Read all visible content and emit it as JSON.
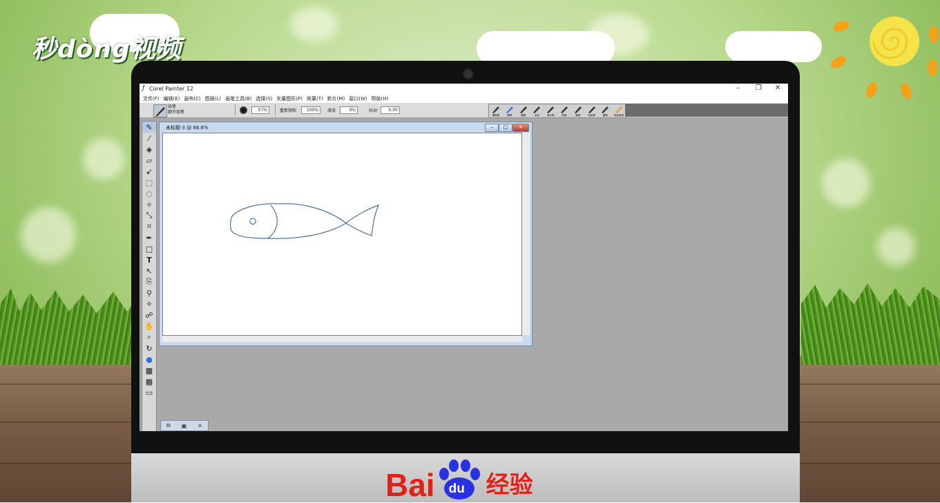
{
  "watermark": {
    "top_logo": "秒dòng视频"
  },
  "brand": {
    "bai": "Bai",
    "du": "du",
    "suffix": "经验"
  },
  "app": {
    "title": "Corel Painter 12",
    "window_controls": [
      "–",
      "❐",
      "✕"
    ],
    "menu": [
      "文件(F)",
      "编辑(E)",
      "画布(C)",
      "图层(L)",
      "画笔工具(B)",
      "选择(S)",
      "矢量图形(P)",
      "效果(T)",
      "影片(M)",
      "窗口(W)",
      "帮助(H)"
    ]
  },
  "property_bar": {
    "brush_category": "铅笔",
    "brush_variant": "细节铅笔",
    "size_value": "57%",
    "opacity_label": "重新饱和",
    "opacity_value": "100%",
    "grain_label": "渗流",
    "grain_value": "0%",
    "jitter_label": "抖动",
    "jitter_value": "0.00"
  },
  "custom_palette": {
    "items": [
      "调和笔",
      "图章",
      "笔刷",
      "水彩",
      "设计笔",
      "粉笔",
      "钢笔",
      "马克笔",
      "蜡笔",
      "彩色铅笔"
    ]
  },
  "document": {
    "title": "未标题-3 @ 66.6%",
    "controls": [
      "–",
      "□",
      "✕"
    ]
  },
  "toolbox": {
    "tools": [
      "brush-tool",
      "dropper-tool",
      "paint-bucket-tool",
      "eraser-tool",
      "layer-adjuster-tool",
      "rect-select-tool",
      "lasso-tool",
      "magic-wand-tool",
      "transform-tool",
      "crop-tool",
      "pen-tool",
      "rect-shape-tool",
      "text-tool",
      "shape-select-tool",
      "cloner-tool",
      "rubber-stamp-tool",
      "dodge-tool",
      "burn-tool",
      "grabber-tool",
      "magnifier-tool",
      "rotate-page-tool",
      "color-swatch",
      "paper-swatch",
      "pattern-swatch",
      "screen-mode"
    ]
  },
  "bottom_bar": {
    "buttons": [
      "⧉",
      "▣",
      "✕"
    ]
  },
  "colors": {
    "stroke": "#4a6fa3",
    "selected_color": "#2f6fd0",
    "workspace_gray": "#a9a9a9",
    "baidu_red": "#e32119",
    "baidu_blue": "#2932e1",
    "sun_orange": "#f6a11a",
    "sun_yellow": "#f5e34a"
  }
}
